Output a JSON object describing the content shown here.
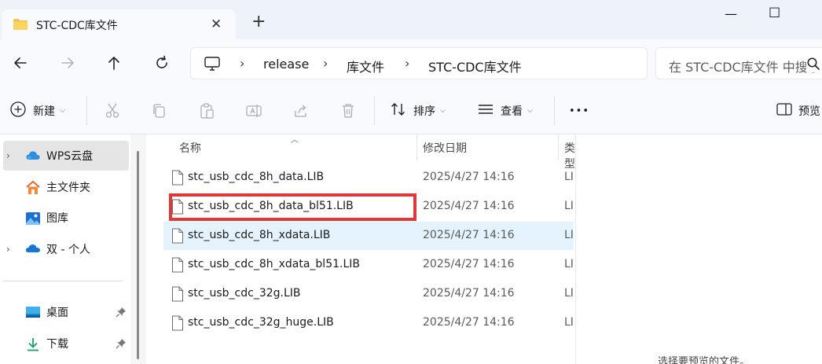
{
  "tab": {
    "title": "STC-CDC库文件",
    "close_glyph": "✕",
    "new_tab_glyph": "+"
  },
  "window_controls": {
    "minimize": "—",
    "maximize": "☐"
  },
  "address": {
    "crumbs": [
      "release",
      "库文件",
      "STC-CDC库文件"
    ],
    "separator": "›",
    "search_placeholder": "在 STC-CDC库文件 中搜索"
  },
  "toolbar": {
    "new_label": "新建",
    "sort_label": "排序",
    "view_label": "查看",
    "more_glyph": "•••",
    "preview_label": "预览",
    "chevron": "⌵"
  },
  "sidebar": {
    "items": [
      {
        "label": "WPS云盘",
        "icon": "cloud-icon",
        "expand": "›"
      },
      {
        "label": "主文件夹",
        "icon": "home-icon"
      },
      {
        "label": "图库",
        "icon": "gallery-icon"
      },
      {
        "label": "双 - 个人",
        "icon": "onedrive-icon",
        "expand": "›"
      },
      {
        "label": "桌面",
        "icon": "desktop-icon"
      },
      {
        "label": "下载",
        "icon": "download-icon"
      }
    ]
  },
  "columns": {
    "name": "名称",
    "date": "修改日期",
    "type": "类型"
  },
  "files": [
    {
      "name": "stc_usb_cdc_8h_data.LIB",
      "date": "2025/4/27 14:16",
      "type": "LIB"
    },
    {
      "name": "stc_usb_cdc_8h_data_bl51.LIB",
      "date": "2025/4/27 14:16",
      "type": "LIB"
    },
    {
      "name": "stc_usb_cdc_8h_xdata.LIB",
      "date": "2025/4/27 14:16",
      "type": "LIB"
    },
    {
      "name": "stc_usb_cdc_8h_xdata_bl51.LIB",
      "date": "2025/4/27 14:16",
      "type": "LIB"
    },
    {
      "name": "stc_usb_cdc_32g.LIB",
      "date": "2025/4/27 14:16",
      "type": "LIB"
    },
    {
      "name": "stc_usb_cdc_32g_huge.LIB",
      "date": "2025/4/27 14:16",
      "type": "LIB"
    }
  ],
  "preview": {
    "message": "选择要预览的文件。"
  },
  "colors": {
    "highlight": "#e0383a",
    "hover_row": "#e5f3ff",
    "accent": "#0067c0",
    "folder": "#f8c44f"
  }
}
